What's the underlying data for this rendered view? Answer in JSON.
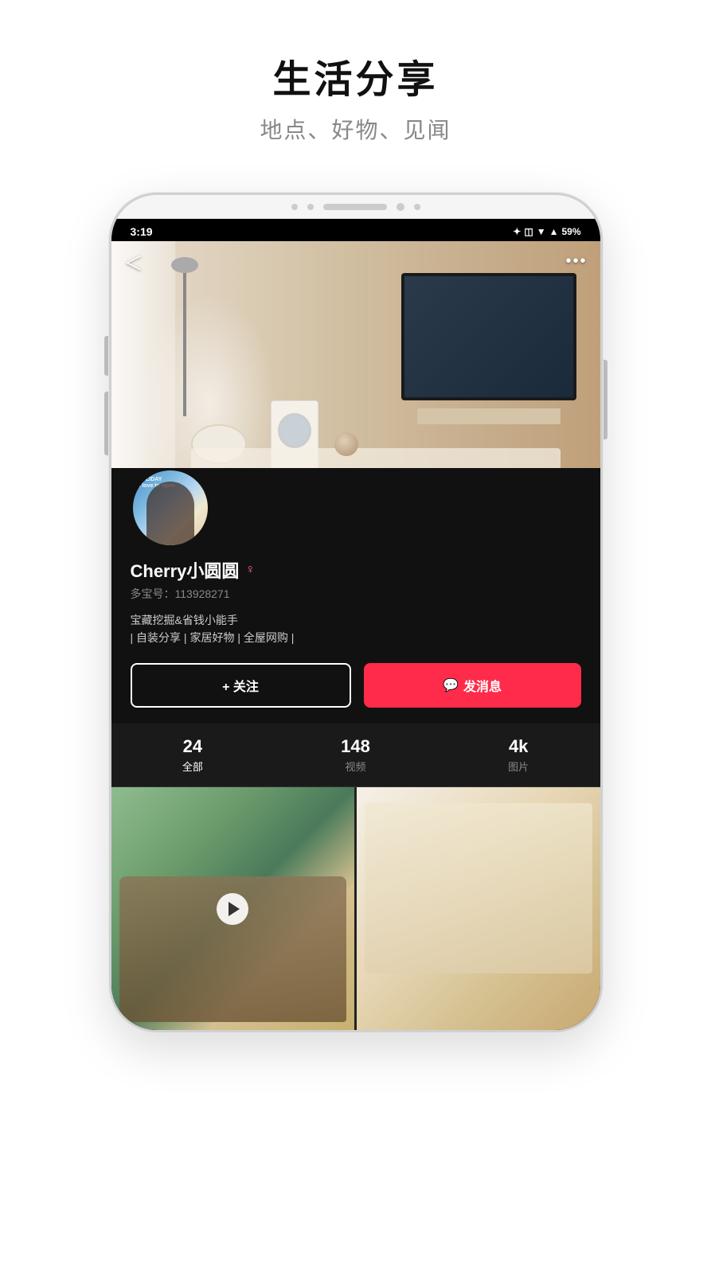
{
  "page": {
    "title": "生活分享",
    "subtitle": "地点、好物、见闻"
  },
  "statusBar": {
    "time": "3:19",
    "battery": "59%",
    "icons": "✦ ◫ ▼ ▲"
  },
  "nav": {
    "back": "＜",
    "more": "•••"
  },
  "profile": {
    "name": "Cherry小圆圆",
    "gender": "♀",
    "idLabel": "多宝号：",
    "id": "113928271",
    "bioLine1": "宝藏挖掘&省钱小能手",
    "bioLine2": "| 自装分享 | 家居好物 | 全屋网购 |",
    "avatarLabel": "HOLIDAY\na love to open"
  },
  "buttons": {
    "follow": "+ 关注",
    "messageIcon": "💬",
    "message": "发消息"
  },
  "stats": [
    {
      "number": "24",
      "label": "全部",
      "active": true
    },
    {
      "number": "148",
      "label": "视频",
      "active": false
    },
    {
      "number": "4k",
      "label": "图片",
      "active": false
    }
  ],
  "grid": [
    {
      "type": "video",
      "bg": "kitchen-basket"
    },
    {
      "type": "image",
      "bg": "kitchen-shelf"
    }
  ]
}
